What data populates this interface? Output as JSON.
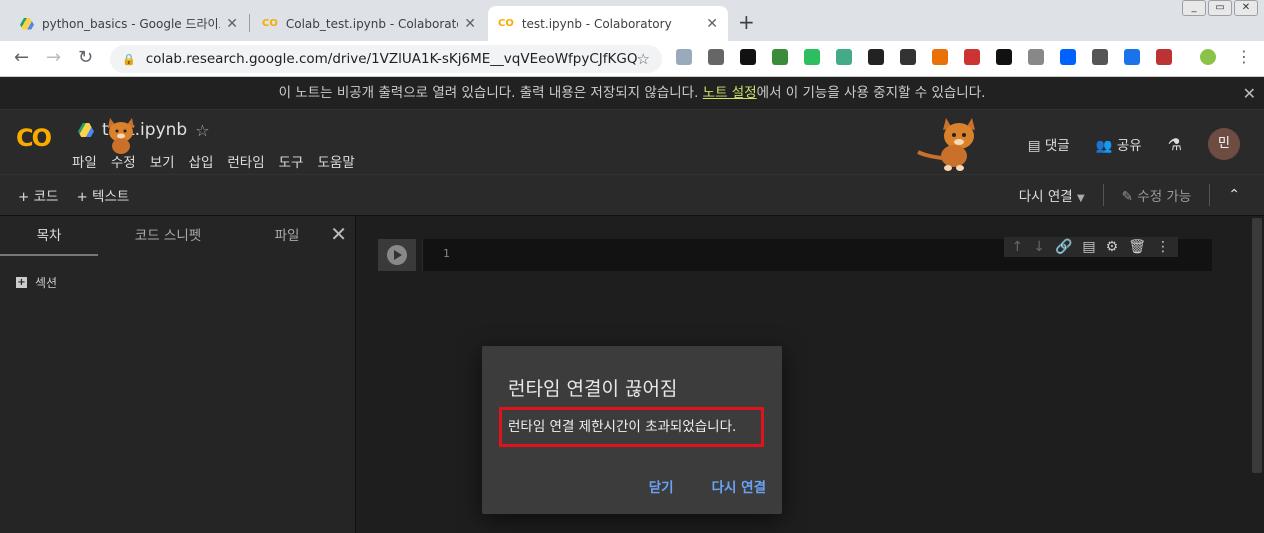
{
  "browser": {
    "tabs": [
      {
        "title": "python_basics - Google 드라이브",
        "icon": "google-drive-icon"
      },
      {
        "title": "Colab_test.ipynb - Colaboratory",
        "icon": "colab-icon"
      },
      {
        "title": "test.ipynb - Colaboratory",
        "icon": "colab-icon",
        "active": true
      }
    ],
    "url": "colab.research.google.com/drive/1VZlUA1K-sKj6ME__vqVEeoWfpyCJfKGQ..."
  },
  "notice": {
    "text_before": "이 노트는 비공개 출력으로 열려 있습니다. 출력 내용은 저장되지 않습니다. ",
    "link": "노트 설정",
    "text_after": "에서 이 기능을 사용 중지할 수 있습니다."
  },
  "colab": {
    "logo": "CO",
    "notebook_title": "test.ipynb",
    "menu": [
      "파일",
      "수정",
      "보기",
      "삽입",
      "런타임",
      "도구",
      "도움말"
    ],
    "comments_label": "댓글",
    "share_label": "공유",
    "avatar_initial": "민"
  },
  "cellbar": {
    "add_code": "+ 코드",
    "add_text": "+ 텍스트",
    "reconnect": "다시 연결",
    "edit_mode": "수정 가능"
  },
  "sidebar": {
    "tabs": [
      "목차",
      "코드 스니펫",
      "파일"
    ],
    "section_label": "섹션"
  },
  "cell": {
    "line_number": "1"
  },
  "dialog": {
    "title": "런타임 연결이 끊어짐",
    "message": "런타임 연결 제한시간이 초과되었습니다.",
    "close_label": "닫기",
    "reconnect_label": "다시 연결"
  },
  "colors": {
    "accent": "#f9ab00",
    "link": "#6aa3f5",
    "highlight_border": "#e0121b"
  }
}
